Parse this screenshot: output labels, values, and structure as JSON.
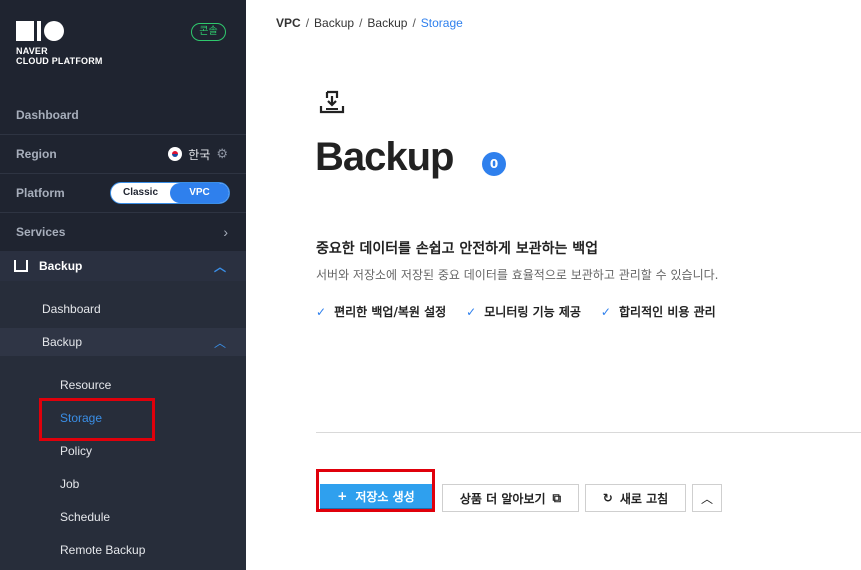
{
  "brand": {
    "line1": "NAVER",
    "line2": "CLOUD PLATFORM",
    "console_badge": "콘솔"
  },
  "sidebar": {
    "dashboard": "Dashboard",
    "region": {
      "label": "Region",
      "value": "한국"
    },
    "platform": {
      "label": "Platform",
      "options": [
        "Classic",
        "VPC"
      ],
      "selected": "VPC"
    },
    "services": "Services",
    "backup_section": "Backup",
    "sub": {
      "dashboard": "Dashboard",
      "backup": "Backup",
      "items": [
        "Resource",
        "Storage",
        "Policy",
        "Job",
        "Schedule",
        "Remote Backup"
      ],
      "selected": "Storage"
    }
  },
  "breadcrumb": [
    "VPC",
    "Backup",
    "Backup",
    "Storage"
  ],
  "main": {
    "title": "Backup",
    "count": "0",
    "subtitle": "중요한 데이터를 손쉽고 안전하게 보관하는 백업",
    "description": "서버와 저장소에 저장된 중요 데이터를 효율적으로 보관하고 관리할 수 있습니다.",
    "features": [
      "편리한 백업/복원 설정",
      "모니터링 기능 제공",
      "합리적인 비용 관리"
    ]
  },
  "actions": {
    "create": "저장소 생성",
    "learn_more": "상품 더 알아보기",
    "refresh": "새로 고침"
  },
  "colors": {
    "accent": "#2f80ed",
    "sidebar_bg": "#1f2430",
    "highlight": "#e0000b",
    "console_green": "#2fc86d"
  }
}
